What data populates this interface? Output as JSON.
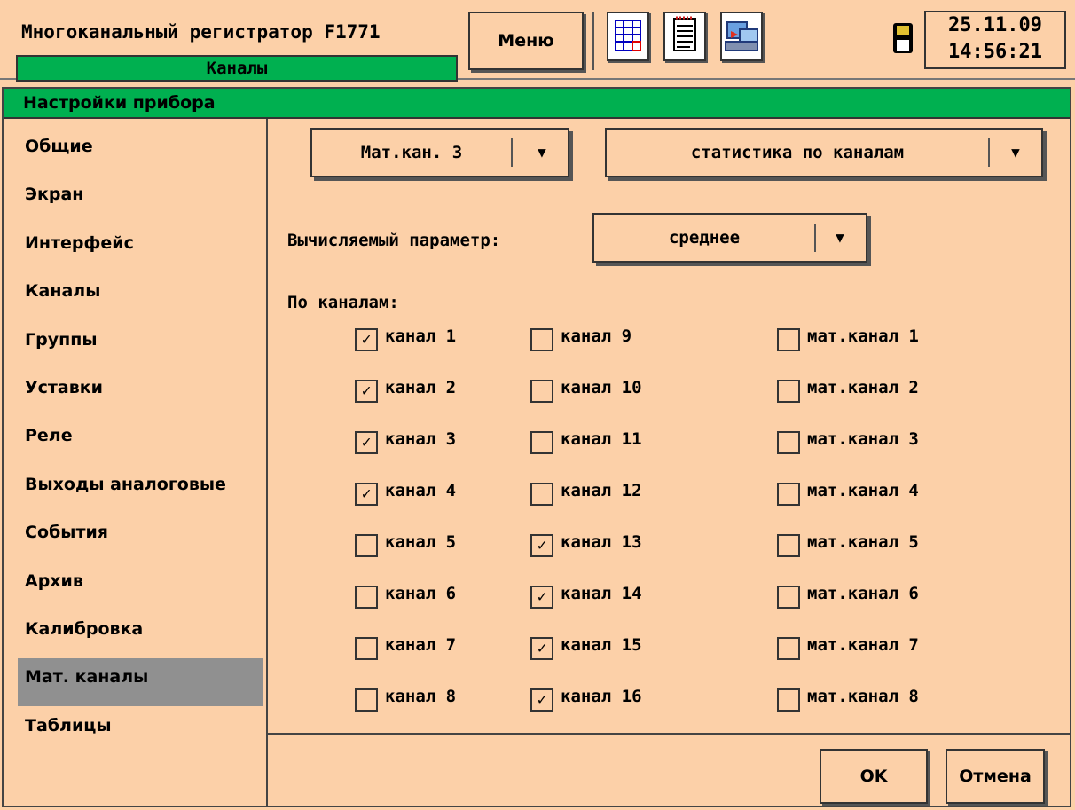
{
  "header": {
    "app_title": "Многоканальный регистратор F1771",
    "subtitle": "Каналы",
    "menu_label": "Меню",
    "date": "25.11.09",
    "time": "14:56:21"
  },
  "window": {
    "title": "Настройки прибора"
  },
  "sidebar": {
    "items": [
      {
        "label": "Общие",
        "active": false
      },
      {
        "label": "Экран",
        "active": false
      },
      {
        "label": "Интерфейс",
        "active": false
      },
      {
        "label": "Каналы",
        "active": false
      },
      {
        "label": "Группы",
        "active": false
      },
      {
        "label": "Уставки",
        "active": false
      },
      {
        "label": "Реле",
        "active": false
      },
      {
        "label": "Выходы аналоговые",
        "active": false
      },
      {
        "label": "События",
        "active": false
      },
      {
        "label": "Архив",
        "active": false
      },
      {
        "label": "Калибровка",
        "active": false
      },
      {
        "label": "Мат. каналы",
        "active": true
      },
      {
        "label": "Таблицы",
        "active": false
      }
    ]
  },
  "content": {
    "channel_select": "Мат.кан. 3",
    "mode_select": "статистика по каналам",
    "param_label": "Вычисляемый параметр:",
    "param_select": "среднее",
    "by_channels_label": "По каналам:",
    "arrow_glyph": "▼",
    "check_glyph": "✓",
    "columns": [
      [
        {
          "label": "канал 1",
          "checked": true
        },
        {
          "label": "канал 2",
          "checked": true
        },
        {
          "label": "канал 3",
          "checked": true
        },
        {
          "label": "канал 4",
          "checked": true
        },
        {
          "label": "канал 5",
          "checked": false
        },
        {
          "label": "канал 6",
          "checked": false
        },
        {
          "label": "канал 7",
          "checked": false
        },
        {
          "label": "канал 8",
          "checked": false
        }
      ],
      [
        {
          "label": "канал 9",
          "checked": false
        },
        {
          "label": "канал 10",
          "checked": false
        },
        {
          "label": "канал 11",
          "checked": false
        },
        {
          "label": "канал 12",
          "checked": false
        },
        {
          "label": "канал 13",
          "checked": true
        },
        {
          "label": "канал 14",
          "checked": true
        },
        {
          "label": "канал 15",
          "checked": true
        },
        {
          "label": "канал 16",
          "checked": true
        }
      ],
      [
        {
          "label": "мат.канал 1",
          "checked": false
        },
        {
          "label": "мат.канал 2",
          "checked": false
        },
        {
          "label": "мат.канал 3",
          "checked": false
        },
        {
          "label": "мат.канал 4",
          "checked": false
        },
        {
          "label": "мат.канал 5",
          "checked": false
        },
        {
          "label": "мат.канал 6",
          "checked": false
        },
        {
          "label": "мат.канал 7",
          "checked": false
        },
        {
          "label": "мат.канал 8",
          "checked": false
        }
      ]
    ],
    "ok_label": "OK",
    "cancel_label": "Отмена"
  },
  "colors": {
    "background": "#fcd0a8",
    "accent_green": "#00b050",
    "selected_item": "#909090"
  },
  "icons": [
    "table-icon",
    "notepad-icon",
    "computer-icon",
    "floppy-disk-icon",
    "dropdown-arrow-icon",
    "checkmark-icon"
  ]
}
